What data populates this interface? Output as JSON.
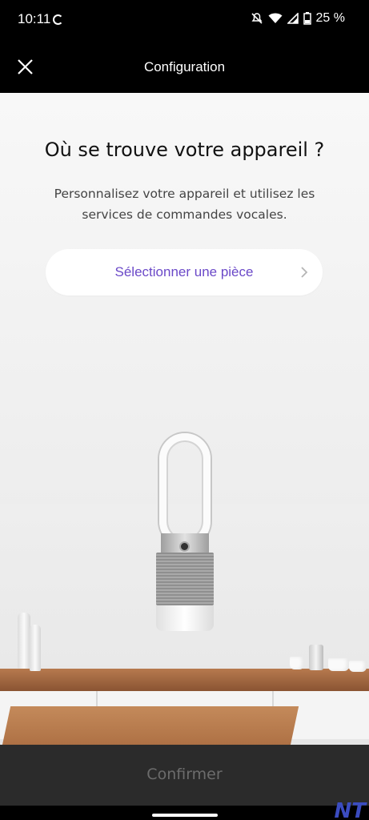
{
  "status_bar": {
    "time": "10:11",
    "battery": "25 %"
  },
  "header": {
    "title": "Configuration",
    "close_icon": "close-icon"
  },
  "main": {
    "title": "Où se trouve votre appareil ?",
    "subtitle_line1": "Personnalisez votre appareil et utilisez les",
    "subtitle_line2": "services de commandes vocales.",
    "select_room_label": "Sélectionner une pièce"
  },
  "footer": {
    "confirm_label": "Confirmer"
  },
  "watermark": "NT",
  "colors": {
    "accent": "#6b49c8",
    "confirm_disabled_bg": "#2b2b2b",
    "confirm_disabled_text": "#6c6c6c"
  }
}
